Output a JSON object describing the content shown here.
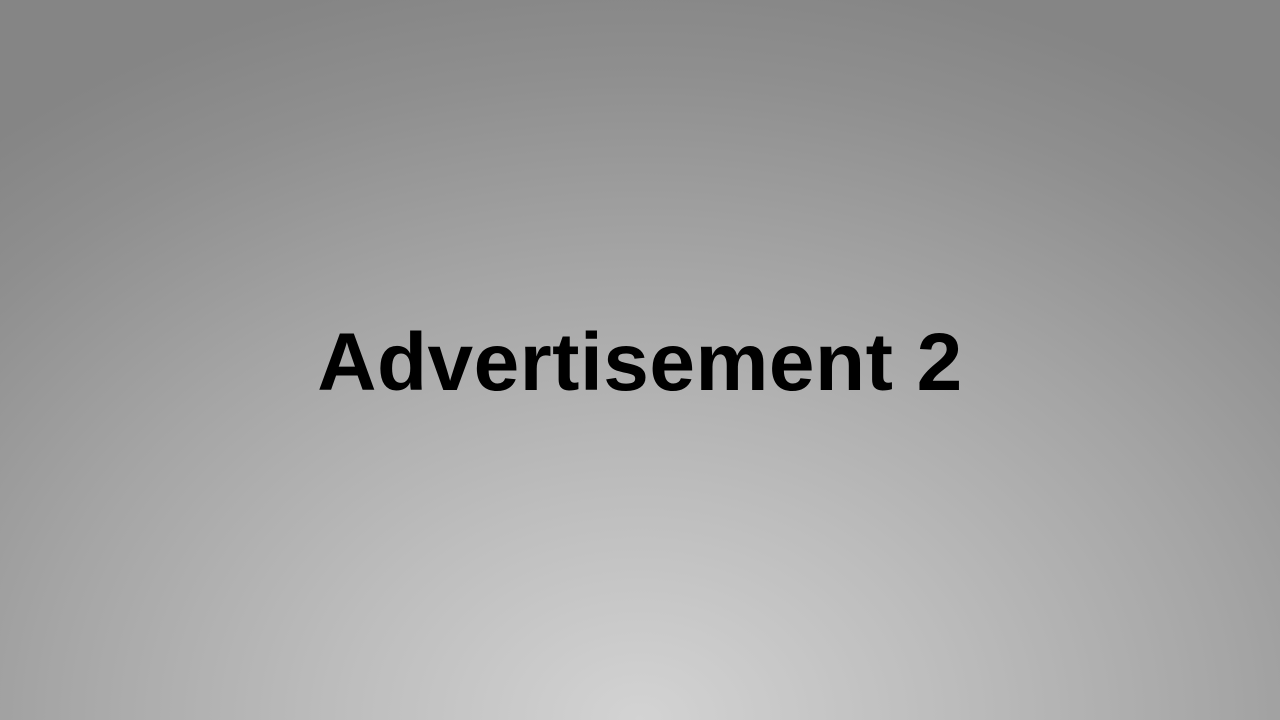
{
  "slide": {
    "title": "Advertisement 2"
  },
  "colors": {
    "text": "#000000",
    "background_center": "#d3d3d3",
    "background_edge": "#858585"
  }
}
